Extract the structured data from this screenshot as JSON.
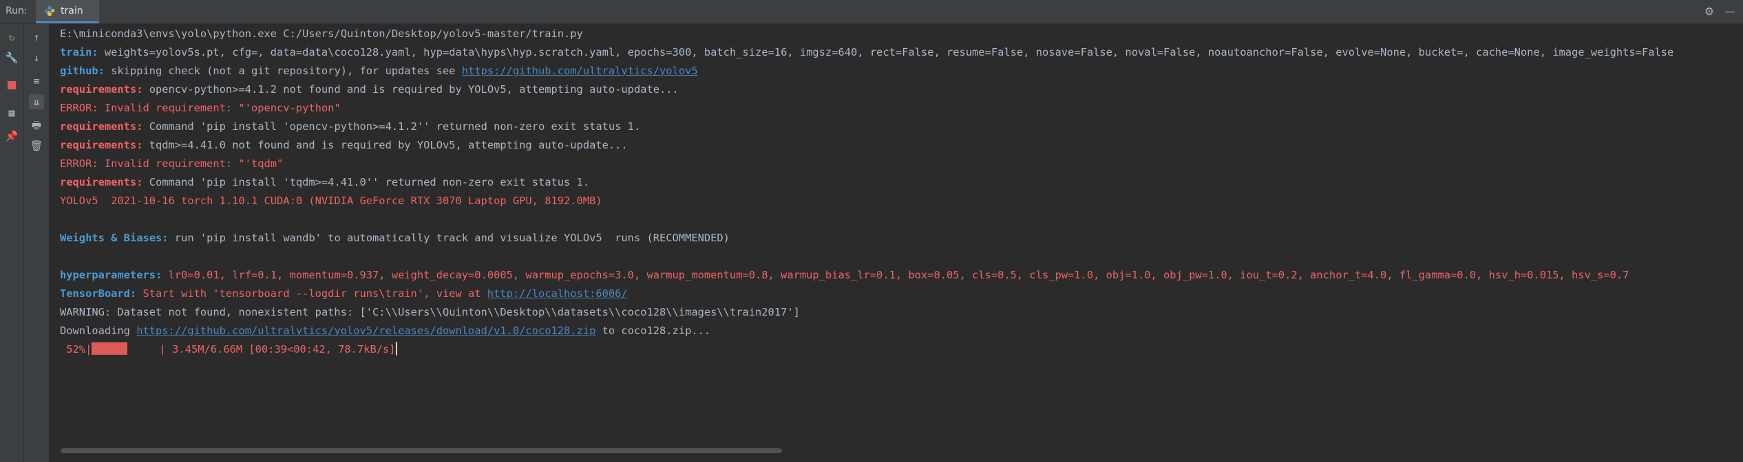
{
  "header": {
    "run_label": "Run:",
    "tab_label": "train"
  },
  "console": {
    "lines": {
      "cmd": "E:\\miniconda3\\envs\\yolo\\python.exe C:/Users/Quinton/Desktop/yolov5-master/train.py",
      "train_key": "train:",
      "train_val": " weights=yolov5s.pt, cfg=, data=data\\coco128.yaml, hyp=data\\hyps\\hyp.scratch.yaml, epochs=300, batch_size=16, imgsz=640, rect=False, resume=False, nosave=False, noval=False, noautoanchor=False, evolve=None, bucket=, cache=None, image_weights=False",
      "github_key": "github:",
      "github_val": " skipping check (not a git repository), for updates see ",
      "github_link": "https://github.com/ultralytics/yolov5",
      "req1_key": "requirements:",
      "req1_val": " opencv-python>=4.1.2 not found and is required by YOLOv5, attempting auto-update...",
      "err1": "ERROR: Invalid requirement: \"'opencv-python\"",
      "req2_key": "requirements:",
      "req2_val": " Command 'pip install 'opencv-python>=4.1.2'' returned non-zero exit status 1.",
      "req3_key": "requirements:",
      "req3_val": " tqdm>=4.41.0 not found and is required by YOLOv5, attempting auto-update...",
      "err2": "ERROR: Invalid requirement: \"'tqdm\"",
      "req4_key": "requirements:",
      "req4_val": " Command 'pip install 'tqdm>=4.41.0'' returned non-zero exit status 1.",
      "yolo_info": "YOLOv5  2021-10-16 torch 1.10.1 CUDA:0 (NVIDIA GeForce RTX 3070 Laptop GPU, 8192.0MB)",
      "wandb_key": "Weights & Biases:",
      "wandb_val": " run 'pip install wandb' to automatically track and visualize YOLOv5  runs (RECOMMENDED)",
      "hyp_key": "hyperparameters:",
      "hyp_val": " lr0=0.01, lrf=0.1, momentum=0.937, weight_decay=0.0005, warmup_epochs=3.0, warmup_momentum=0.8, warmup_bias_lr=0.1, box=0.05, cls=0.5, cls_pw=1.0, obj=1.0, obj_pw=1.0, iou_t=0.2, anchor_t=4.0, fl_gamma=0.0, hsv_h=0.015, hsv_s=0.7",
      "tb_key": "TensorBoard:",
      "tb_val": " Start with 'tensorboard --logdir runs\\train', view at ",
      "tb_link": "http://localhost:6006/",
      "warning": "WARNING: Dataset not found, nonexistent paths: ['C:\\\\Users\\\\Quinton\\\\Desktop\\\\datasets\\\\coco128\\\\images\\\\train2017']",
      "dl_prefix": "Downloading ",
      "dl_link": "https://github.com/ultralytics/yolov5/releases/download/v1.0/coco128.zip",
      "dl_suffix": " to coco128.zip...",
      "prog_pct": " 52%|",
      "prog_rest": "     | 3.45M/6.66M [00:39<00:42, 78.7kB/s]"
    },
    "progress_fraction": 0.52
  },
  "icons": {
    "header": [
      "python-icon",
      "settings-icon",
      "minimize-icon"
    ],
    "bar1": [
      "rerun-icon",
      "wrench-icon",
      "stop-icon",
      "layout-icon",
      "pin-icon"
    ],
    "bar2": [
      "up-arrow-icon",
      "down-arrow-icon",
      "soft-wrap-icon",
      "scroll-to-end-icon",
      "print-icon",
      "trash-icon"
    ]
  },
  "colors": {
    "background": "#2b2b2b",
    "text": "#a9b7c6",
    "key_blue": "#4a9ad4",
    "error_red": "#f06363",
    "link": "#4a88c7"
  }
}
